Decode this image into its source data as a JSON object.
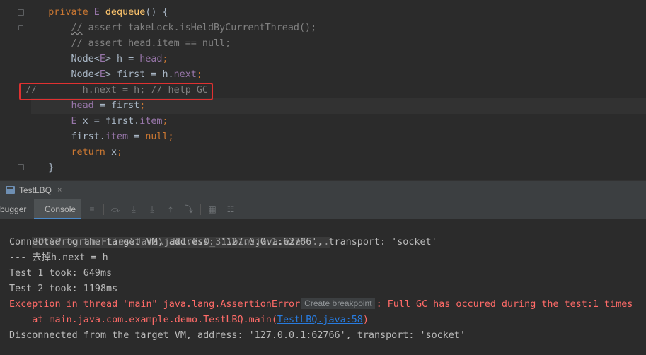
{
  "editor": {
    "lines": [
      {
        "indent": "    ",
        "parts": [
          {
            "c": "kw",
            "t": "private "
          },
          {
            "c": "tp",
            "t": "E "
          },
          {
            "c": "fn",
            "t": "dequeue"
          },
          {
            "c": "",
            "t": "() {"
          }
        ]
      },
      {
        "indent": "        ",
        "parts": [
          {
            "c": "cm wave",
            "t": "//"
          },
          {
            "c": "cm",
            "t": " assert takeLock.isHeldByCurrentThread();"
          }
        ]
      },
      {
        "indent": "        ",
        "parts": [
          {
            "c": "cm",
            "t": "// assert head.item == null;"
          }
        ]
      },
      {
        "indent": "        ",
        "parts": [
          {
            "c": "",
            "t": "Node<"
          },
          {
            "c": "tp",
            "t": "E"
          },
          {
            "c": "",
            "t": "> h = "
          },
          {
            "c": "fld",
            "t": "head"
          },
          {
            "c": "kw",
            "t": ";"
          }
        ]
      },
      {
        "indent": "        ",
        "parts": [
          {
            "c": "",
            "t": "Node<"
          },
          {
            "c": "tp",
            "t": "E"
          },
          {
            "c": "",
            "t": "> first = h."
          },
          {
            "c": "fld",
            "t": "next"
          },
          {
            "c": "kw",
            "t": ";"
          }
        ]
      },
      {
        "indent": "",
        "parts": [
          {
            "c": "cm",
            "t": "//        h.next = h; // help GC"
          }
        ]
      },
      {
        "indent": "        ",
        "parts": [
          {
            "c": "fld",
            "t": "head"
          },
          {
            "c": "",
            "t": " = first"
          },
          {
            "c": "kw",
            "t": ";"
          }
        ]
      },
      {
        "indent": "        ",
        "parts": [
          {
            "c": "tp",
            "t": "E"
          },
          {
            "c": "",
            "t": " x = first."
          },
          {
            "c": "fld",
            "t": "item"
          },
          {
            "c": "kw",
            "t": ";"
          }
        ]
      },
      {
        "indent": "        ",
        "parts": [
          {
            "c": "",
            "t": "first."
          },
          {
            "c": "fld",
            "t": "item"
          },
          {
            "c": "",
            "t": " = "
          },
          {
            "c": "kw",
            "t": "null;"
          }
        ]
      },
      {
        "indent": "        ",
        "parts": [
          {
            "c": "kw",
            "t": "return "
          },
          {
            "c": "",
            "t": "x"
          },
          {
            "c": "kw",
            "t": ";"
          }
        ]
      },
      {
        "indent": "    ",
        "parts": [
          {
            "c": "",
            "t": "}"
          }
        ]
      }
    ]
  },
  "run_tab": {
    "label": "TestLBQ",
    "close": "×"
  },
  "sub_tabs": {
    "debugger": "bugger",
    "console": "Console"
  },
  "console": {
    "cmd": "\"D:\\Program Files\\Java\\jdk1.8.0_31\\bin\\java.exe\" ...",
    "connected": "Connected to the target VM, address: '127.0.0.1:62766', transport: 'socket'",
    "line3": "--- 去掉h.next = h",
    "test1": "Test 1 took: 649ms",
    "test2": "Test 2 took: 1198ms",
    "exc_prefix": "Exception in thread \"main\" java.lang.",
    "exc_class": "AssertionError",
    "tooltip": "Create breakpoint",
    "exc_msg": ": Full GC has occured during the test:1 times",
    "at_prefix": "    at main.java.com.example.demo.TestLBQ.main(",
    "at_link": "TestLBQ.java:58",
    "at_suffix": ")",
    "disconnected": "Disconnected from the target VM, address: '127.0.0.1:62766', transport: 'socket'"
  },
  "colors": {
    "error": "#ff6b68",
    "link": "#287bde",
    "highlight": "#e03131"
  }
}
